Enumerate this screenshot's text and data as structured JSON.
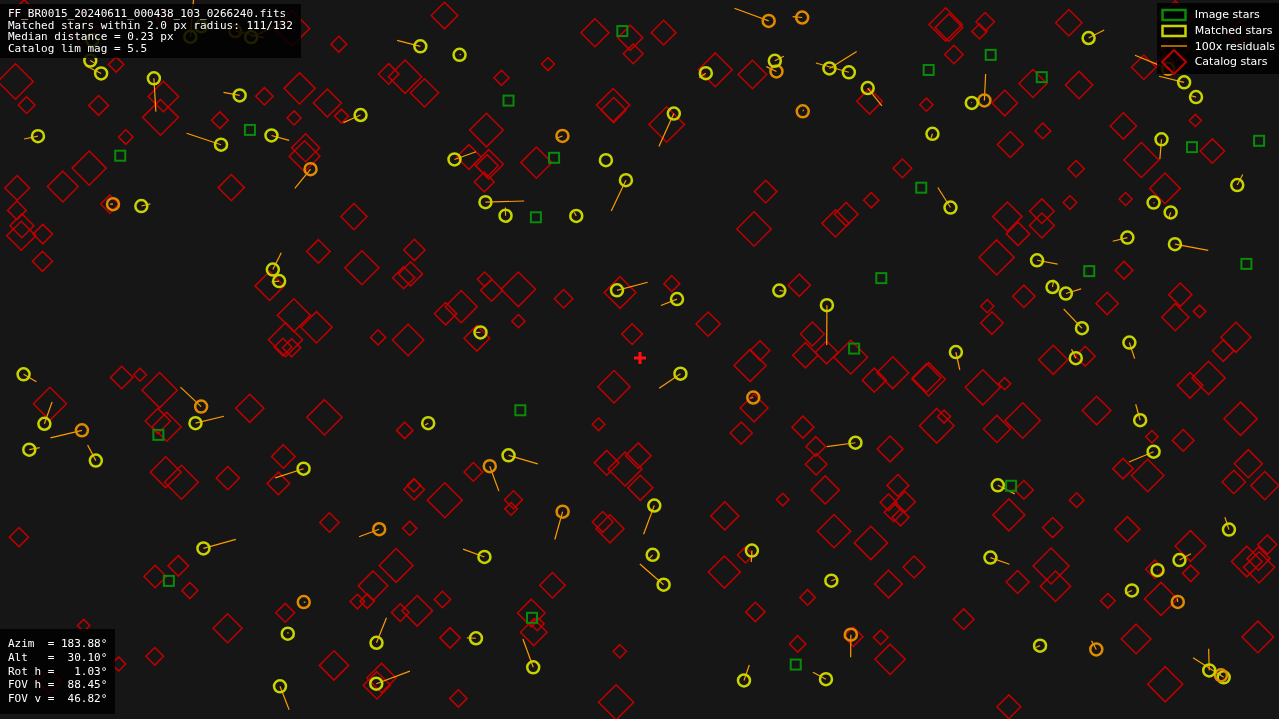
{
  "info_lines": [
    "FF_BR0015_20240611_000438_103_0266240.fits",
    "Matched stars within 2.0 px radius: 111/132",
    "Median distance = 0.23 px",
    "Catalog lim mag = 5.5"
  ],
  "legend": [
    {
      "kind": "image",
      "label": "Image stars"
    },
    {
      "kind": "matched",
      "label": "Matched stars"
    },
    {
      "kind": "residual",
      "label": "100x residuals"
    },
    {
      "kind": "catalog",
      "label": "Catalog stars"
    }
  ],
  "pointing_lines": [
    "Azim  = 183.88°",
    "Alt   =  30.10°",
    "Rot h =   1.03°",
    "FOV h =  88.45°",
    "FOV v =  46.82°"
  ]
}
